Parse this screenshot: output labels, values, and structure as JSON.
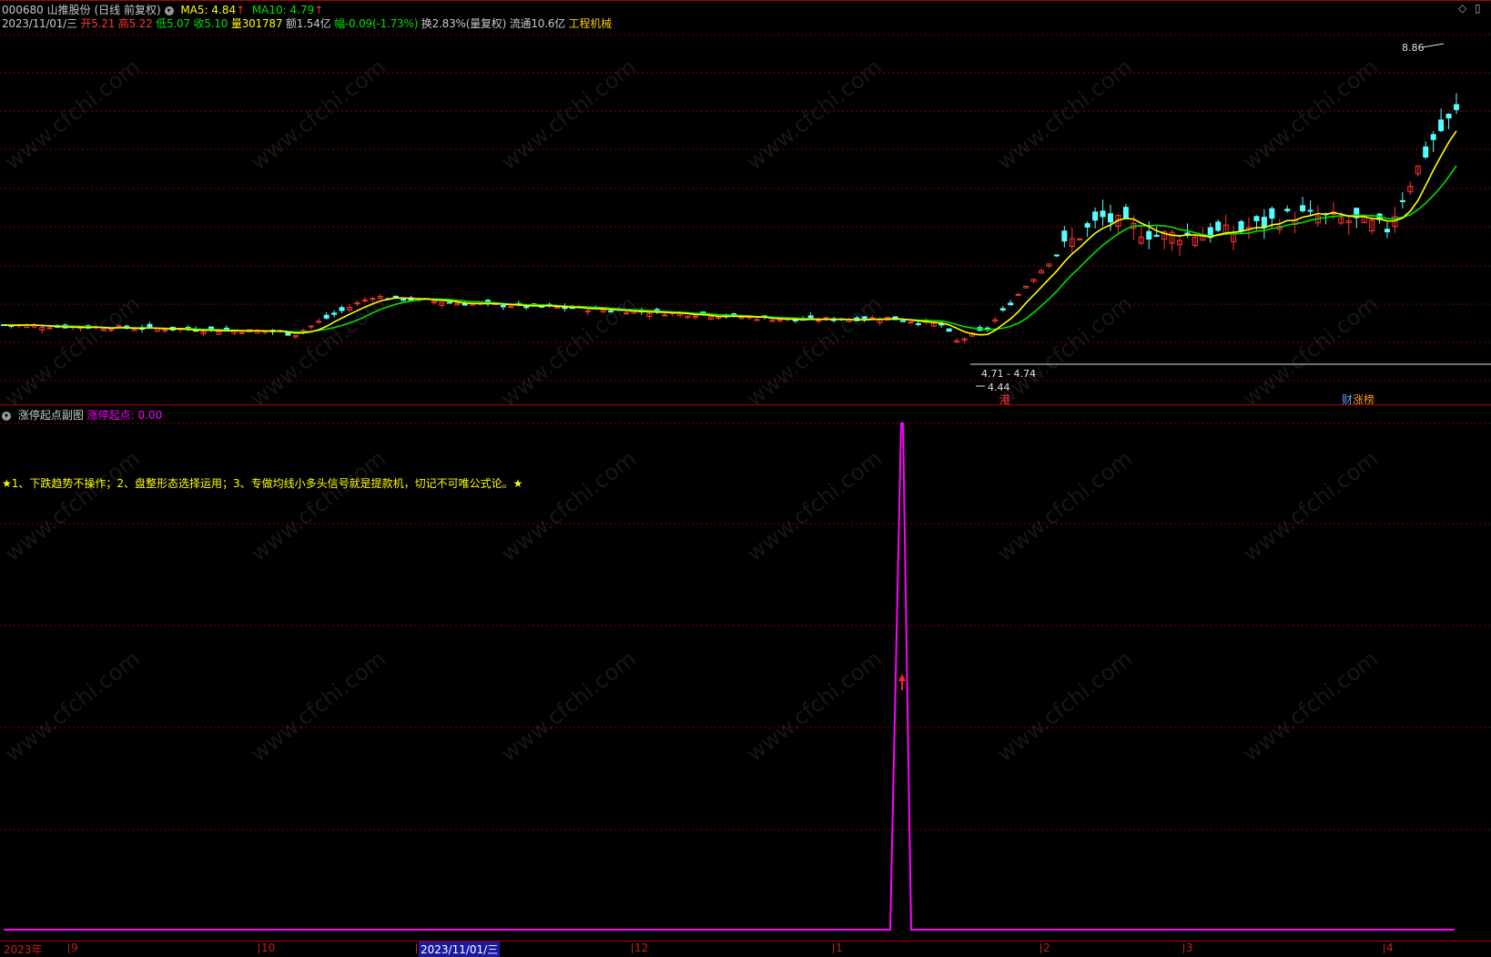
{
  "header": {
    "code": "000680",
    "name": "山推股份",
    "period": "(日线 前复权)",
    "ma5_label": "MA5: ",
    "ma5_value": "4.84",
    "ma5_arrow": "↑",
    "ma10_label": "MA10: ",
    "ma10_value": "4.79",
    "ma10_arrow": "↑"
  },
  "info_line": {
    "date": "2023/11/01/三",
    "open_label": "开",
    "open": "5.21",
    "high_label": "高",
    "high": "5.22",
    "low_label": "低",
    "low": "5.07",
    "close_label": "收",
    "close": "5.10",
    "vol_label": "量",
    "vol": "301787",
    "amount_label": "额",
    "amount": "1.54亿",
    "change_label": "幅",
    "change": "-0.09(-1.73%)",
    "turnover": "换2.83%(量复权)",
    "float_cap": "流通10.6亿",
    "sector": "工程机械"
  },
  "annotations": {
    "max_price": "8.86",
    "min_price": "4.44",
    "range": "4.71 - 4.74",
    "tag_hk": "港",
    "tag_cai": "财",
    "tag_zhang": "涨榜"
  },
  "watermark": "www.cfchi.com",
  "sub_panel": {
    "title": "涨停起点副图",
    "indicator_label": "涨停起点: ",
    "indicator_value": "0.00",
    "note": "★1、下跌趋势不操作；2、盘整形态选择运用；3、专做均线小多头信号就是提款机，切记不可唯公式论。★"
  },
  "x_axis": {
    "labels": [
      "2023年",
      "9",
      "10",
      "2023/11/01/三",
      "12",
      "1",
      "2",
      "3",
      "4"
    ]
  },
  "colors": {
    "up": "#ff3333",
    "down": "#54ffff",
    "ma5": "#ffff00",
    "ma10": "#00e000",
    "indicator": "#ff00ff",
    "grid": "#8a0000"
  },
  "chart_data": {
    "type": "candlestick",
    "series": [
      {
        "name": "MA5",
        "values": [
          4.84
        ]
      },
      {
        "name": "MA10",
        "values": [
          4.79
        ]
      }
    ],
    "y_extremes": {
      "max": 8.86,
      "min": 4.44
    },
    "indicator": {
      "name": "涨停起点",
      "value": 0.0
    }
  }
}
